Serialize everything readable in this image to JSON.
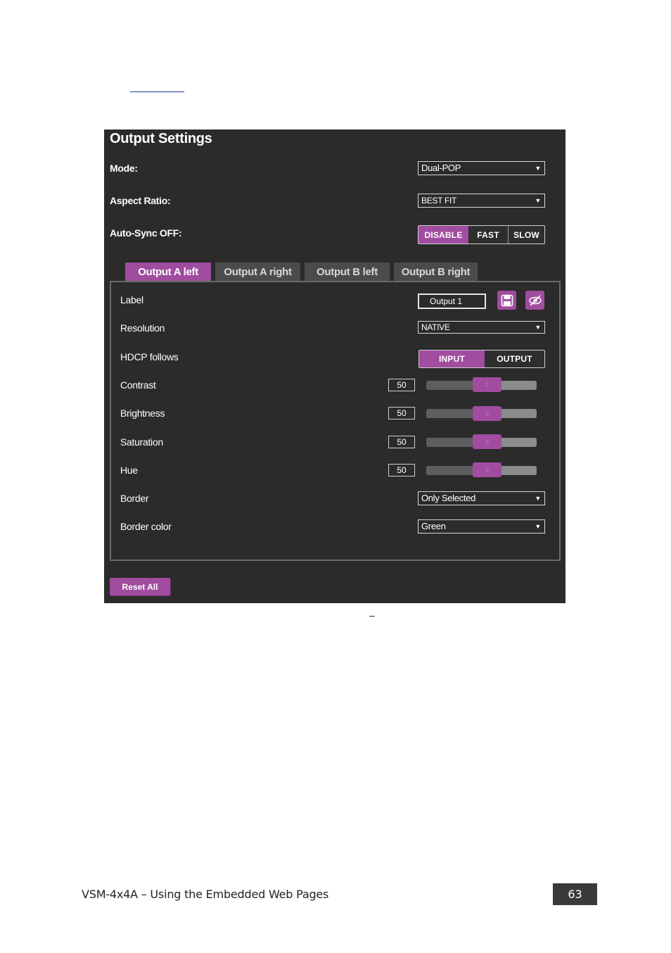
{
  "panel": {
    "title": "Output Settings",
    "mode": {
      "label": "Mode:",
      "value": "Dual-POP"
    },
    "aspect_ratio": {
      "label": "Aspect Ratio:",
      "value": "BEST FIT"
    },
    "auto_sync": {
      "label": "Auto-Sync OFF:",
      "options": [
        "DISABLE",
        "FAST",
        "SLOW"
      ],
      "selected": "DISABLE"
    },
    "tabs": [
      "Output A left",
      "Output A right",
      "Output B left",
      "Output B right"
    ],
    "active_tab": "Output A left",
    "fields": {
      "label": {
        "label": "Label",
        "value": "Output  1"
      },
      "resolution": {
        "label": "Resolution",
        "value": "NATIVE"
      },
      "hdcp": {
        "label": "HDCP follows",
        "options": [
          "INPUT",
          "OUTPUT"
        ],
        "selected": "INPUT"
      },
      "contrast": {
        "label": "Contrast",
        "value": "50",
        "level_percent": 50
      },
      "brightness": {
        "label": "Brightness",
        "value": "50",
        "level_percent": 50
      },
      "saturation": {
        "label": "Saturation",
        "value": "50",
        "level_percent": 50
      },
      "hue": {
        "label": "Hue",
        "value": "50",
        "level_percent": 50
      },
      "border": {
        "label": "Border",
        "value": "Only Selected"
      },
      "border_color": {
        "label": "Border color",
        "value": "Green"
      }
    },
    "reset_label": "Reset All",
    "icons": {
      "save": "save-icon",
      "hide": "eye-slash-icon",
      "dropdown": "chevron-down-icon"
    },
    "colors": {
      "accent": "#a04c9f",
      "panel_bg": "#2b2b2b"
    }
  },
  "caption_dash": "–",
  "footer": {
    "text": "VSM-4x4A – Using the Embedded Web Pages",
    "page": "63"
  }
}
